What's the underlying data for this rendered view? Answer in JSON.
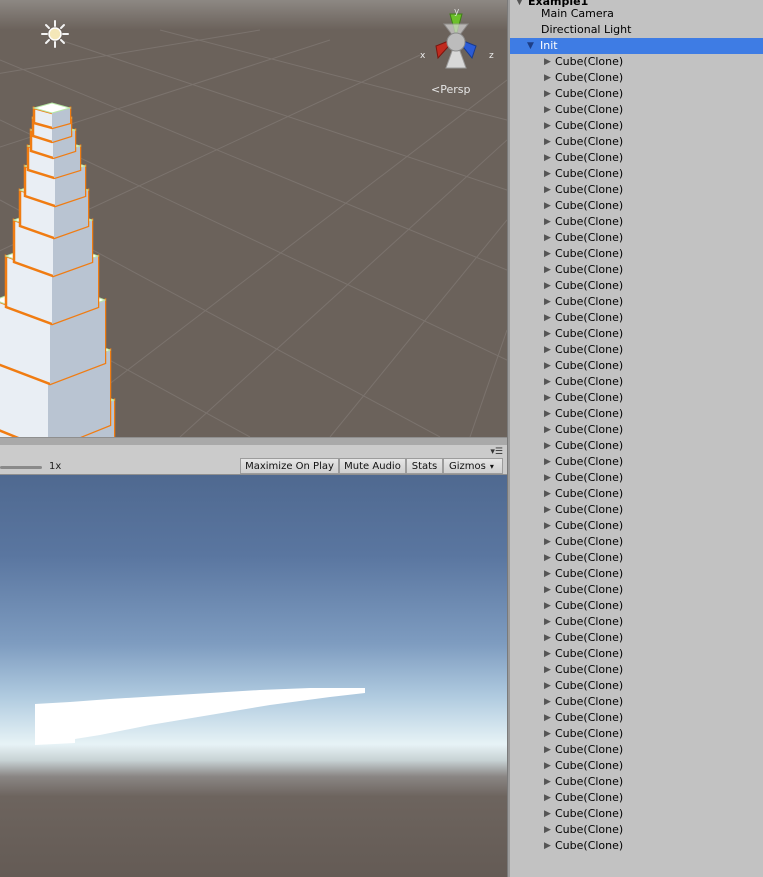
{
  "scene_view": {
    "camera_mode": "Persp",
    "axes": {
      "x": "x",
      "y": "y",
      "z": "z"
    },
    "sun_icon": "sun-icon"
  },
  "game_view": {
    "scale_label": "1x",
    "buttons": {
      "maximize": "Maximize On Play",
      "mute": "Mute Audio",
      "stats": "Stats",
      "gizmos": "Gizmos"
    }
  },
  "hierarchy": {
    "scene_name": "Example1",
    "objects": [
      {
        "name": "Main Camera"
      },
      {
        "name": "Directional Light"
      },
      {
        "name": "Init",
        "selected": true,
        "expanded": true
      }
    ],
    "children": [
      "Cube(Clone)",
      "Cube(Clone)",
      "Cube(Clone)",
      "Cube(Clone)",
      "Cube(Clone)",
      "Cube(Clone)",
      "Cube(Clone)",
      "Cube(Clone)",
      "Cube(Clone)",
      "Cube(Clone)",
      "Cube(Clone)",
      "Cube(Clone)",
      "Cube(Clone)",
      "Cube(Clone)",
      "Cube(Clone)",
      "Cube(Clone)",
      "Cube(Clone)",
      "Cube(Clone)",
      "Cube(Clone)",
      "Cube(Clone)",
      "Cube(Clone)",
      "Cube(Clone)",
      "Cube(Clone)",
      "Cube(Clone)",
      "Cube(Clone)",
      "Cube(Clone)",
      "Cube(Clone)",
      "Cube(Clone)",
      "Cube(Clone)",
      "Cube(Clone)",
      "Cube(Clone)",
      "Cube(Clone)",
      "Cube(Clone)",
      "Cube(Clone)",
      "Cube(Clone)",
      "Cube(Clone)",
      "Cube(Clone)",
      "Cube(Clone)",
      "Cube(Clone)",
      "Cube(Clone)",
      "Cube(Clone)",
      "Cube(Clone)",
      "Cube(Clone)",
      "Cube(Clone)",
      "Cube(Clone)",
      "Cube(Clone)",
      "Cube(Clone)",
      "Cube(Clone)",
      "Cube(Clone)",
      "Cube(Clone)"
    ]
  },
  "colors": {
    "selection": "#3e7ce4",
    "outline": "#f07c12",
    "x_axis": "#c02a1e",
    "y_axis": "#6cc02a",
    "z_axis": "#2a5bd6"
  }
}
